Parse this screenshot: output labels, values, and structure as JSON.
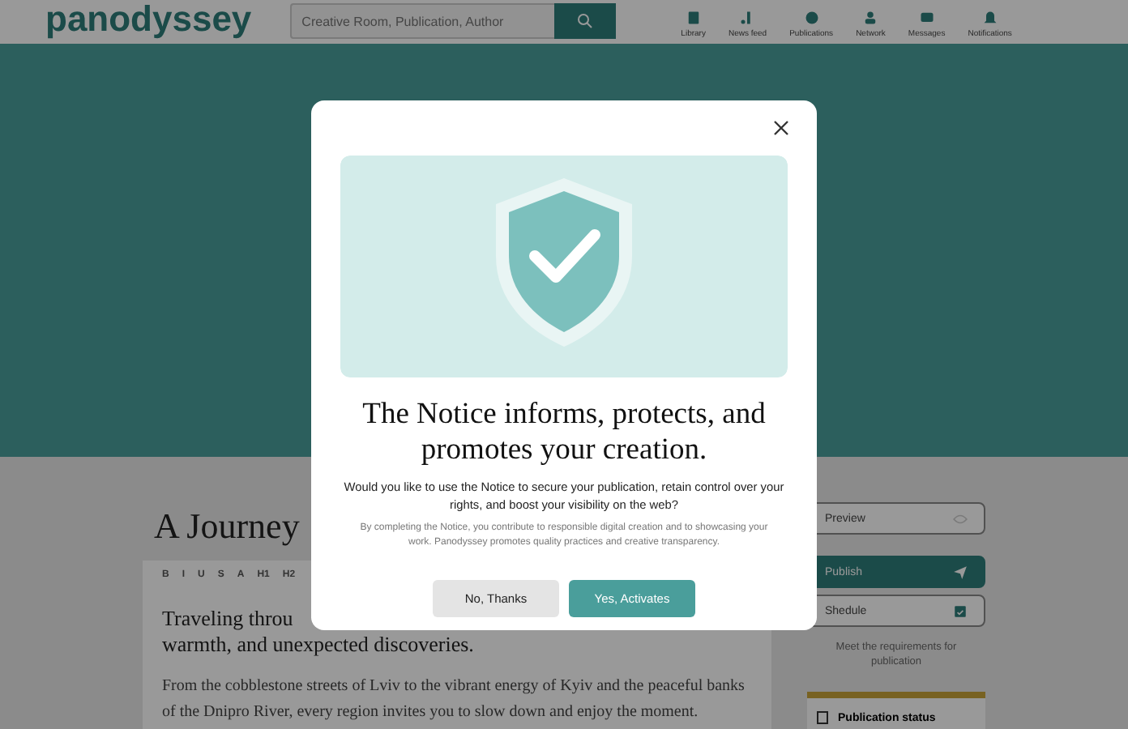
{
  "header": {
    "logo": "panodyssey",
    "search": {
      "placeholder": "Creative Room, Publication, Author"
    },
    "nav": [
      {
        "label": "Library"
      },
      {
        "label": "News feed"
      },
      {
        "label": "Publications"
      },
      {
        "label": "Network"
      },
      {
        "label": "Messages"
      },
      {
        "label": "Notifications"
      }
    ]
  },
  "editor": {
    "title": "A Journey",
    "toolbar": [
      "B",
      "I",
      "U",
      "S",
      "A",
      "H1",
      "H2"
    ],
    "heading_lines": [
      "Traveling throu",
      "warmth, and unexpected discoveries."
    ],
    "paragraph": "From the cobblestone streets of Lviv to the vibrant energy of Kyiv and the peaceful banks of the Dnipro River, every region invites you to slow down and enjoy the moment."
  },
  "sidebar": {
    "actions": [
      {
        "label": "Preview",
        "kind": "outline"
      },
      {
        "label": "Publish",
        "kind": "primary"
      },
      {
        "label": "Shedule",
        "kind": "outline"
      }
    ],
    "note": "Meet the requirements for publication",
    "status_title": "Publication status"
  },
  "modal": {
    "title": "The Notice informs, protects, and promotes your creation.",
    "question": "Would you like to use the Notice to secure your publication, retain control over your rights, and boost your visibility on the web?",
    "fine_print": "By completing the Notice, you contribute to responsible digital creation and to showcasing your work. Panodyssey promotes quality practices and creative transparency.",
    "buttons": [
      {
        "label": "No, Thanks",
        "kind": "secondary"
      },
      {
        "label": "Yes, Activates",
        "kind": "primary"
      }
    ]
  }
}
